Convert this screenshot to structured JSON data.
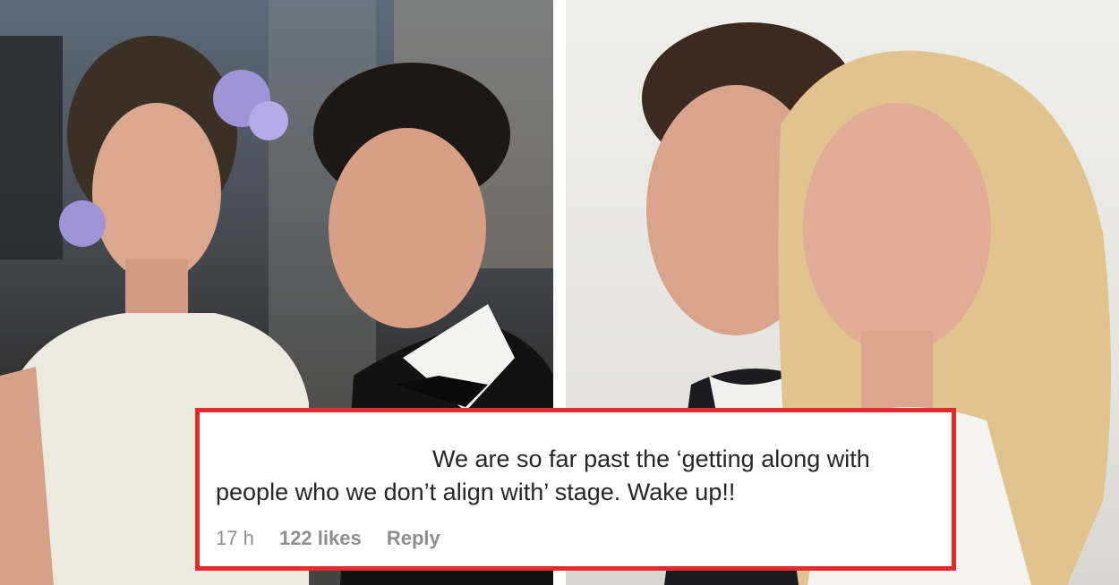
{
  "comment": {
    "text_line1": "We are so far past the ‘getting along with",
    "text_line2": "people who we don’t align with’ stage. Wake up!!",
    "time": "17 h",
    "likes": "122 likes",
    "reply_label": "Reply"
  },
  "colors": {
    "highlight_border": "#e32b2b",
    "comment_text": "#262626",
    "meta_text": "#8e8e8e"
  }
}
